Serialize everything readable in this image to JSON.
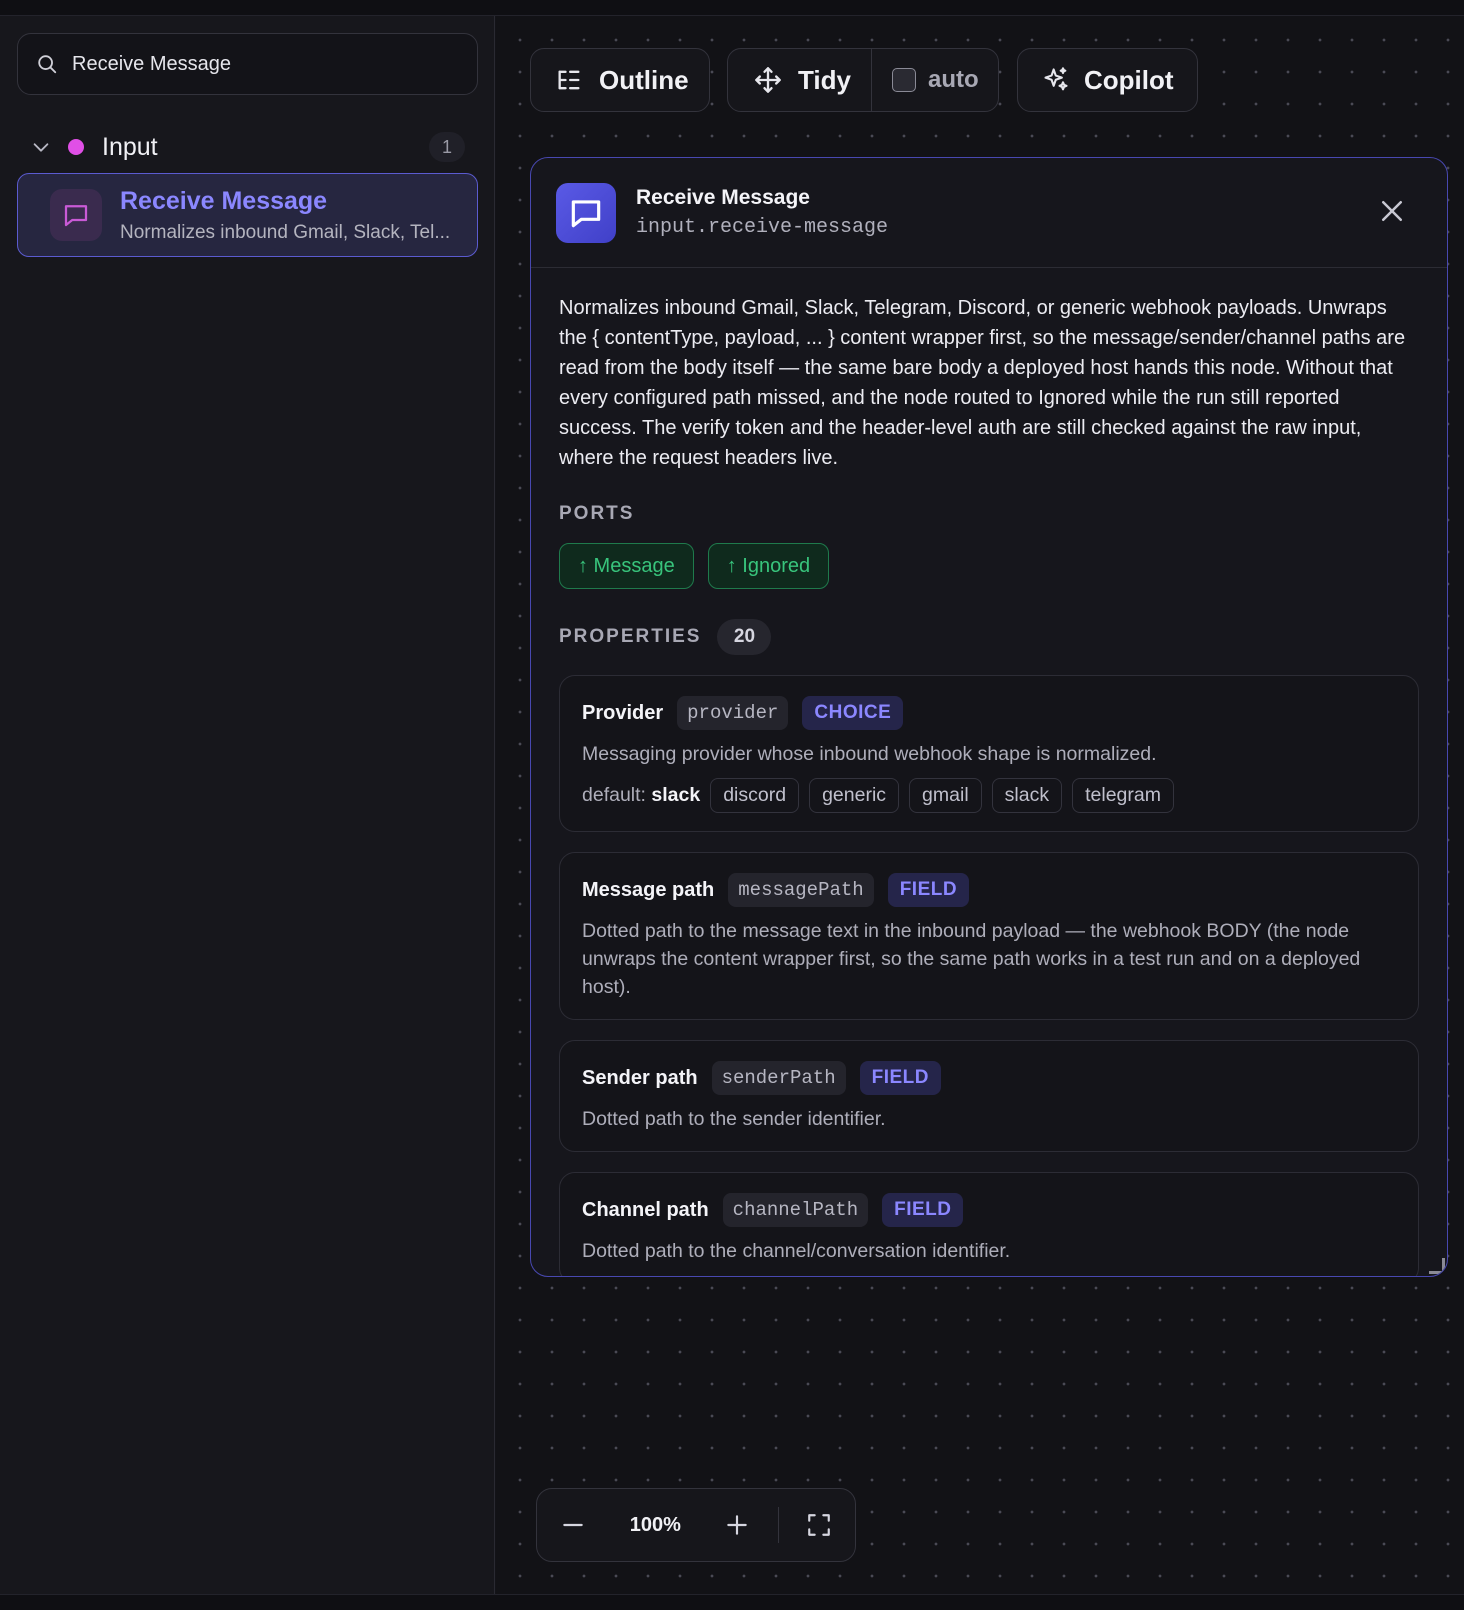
{
  "sidebar": {
    "search": {
      "value": "Receive Message",
      "icon": "search-icon"
    },
    "group": {
      "label": "Input",
      "count": "1",
      "dot_color": "#e04fe6"
    },
    "node": {
      "title": "Receive Message",
      "subtitle": "Normalizes inbound Gmail, Slack, Tel..."
    }
  },
  "toolbar": {
    "outline_label": "Outline",
    "tidy_label": "Tidy",
    "auto_label": "auto",
    "auto_checked": false,
    "copilot_label": "Copilot"
  },
  "panel": {
    "title": "Receive Message",
    "node_id": "input.receive-message",
    "description": "Normalizes inbound Gmail, Slack, Telegram, Discord, or generic webhook payloads. Unwraps the { contentType, payload, ... } content wrapper first, so the message/sender/channel paths are read from the body itself — the same bare body a deployed host hands this node. Without that every configured path missed, and the node routed to Ignored while the run still reported success. The verify token and the header-level auth are still checked against the raw input, where the request headers live.",
    "ports_label": "PORTS",
    "ports": [
      "↑ Message",
      "↑ Ignored"
    ],
    "properties_label": "PROPERTIES",
    "properties_count": "20",
    "properties": [
      {
        "name": "Provider",
        "key": "provider",
        "kind": "CHOICE",
        "description": "Messaging provider whose inbound webhook shape is normalized.",
        "default_label": "default:",
        "default_value": "slack",
        "options": [
          "discord",
          "generic",
          "gmail",
          "slack",
          "telegram"
        ]
      },
      {
        "name": "Message path",
        "key": "messagePath",
        "kind": "FIELD",
        "description": "Dotted path to the message text in the inbound payload — the webhook BODY (the node unwraps the content wrapper first, so the same path works in a test run and on a deployed host)."
      },
      {
        "name": "Sender path",
        "key": "senderPath",
        "kind": "FIELD",
        "description": "Dotted path to the sender identifier."
      },
      {
        "name": "Channel path",
        "key": "channelPath",
        "kind": "FIELD",
        "description": "Dotted path to the channel/conversation identifier."
      }
    ]
  },
  "zoom": {
    "value": "100%"
  },
  "colors": {
    "accent": "#8b87ff",
    "port_green": "#38c47c",
    "panel_border": "#4848b0"
  }
}
